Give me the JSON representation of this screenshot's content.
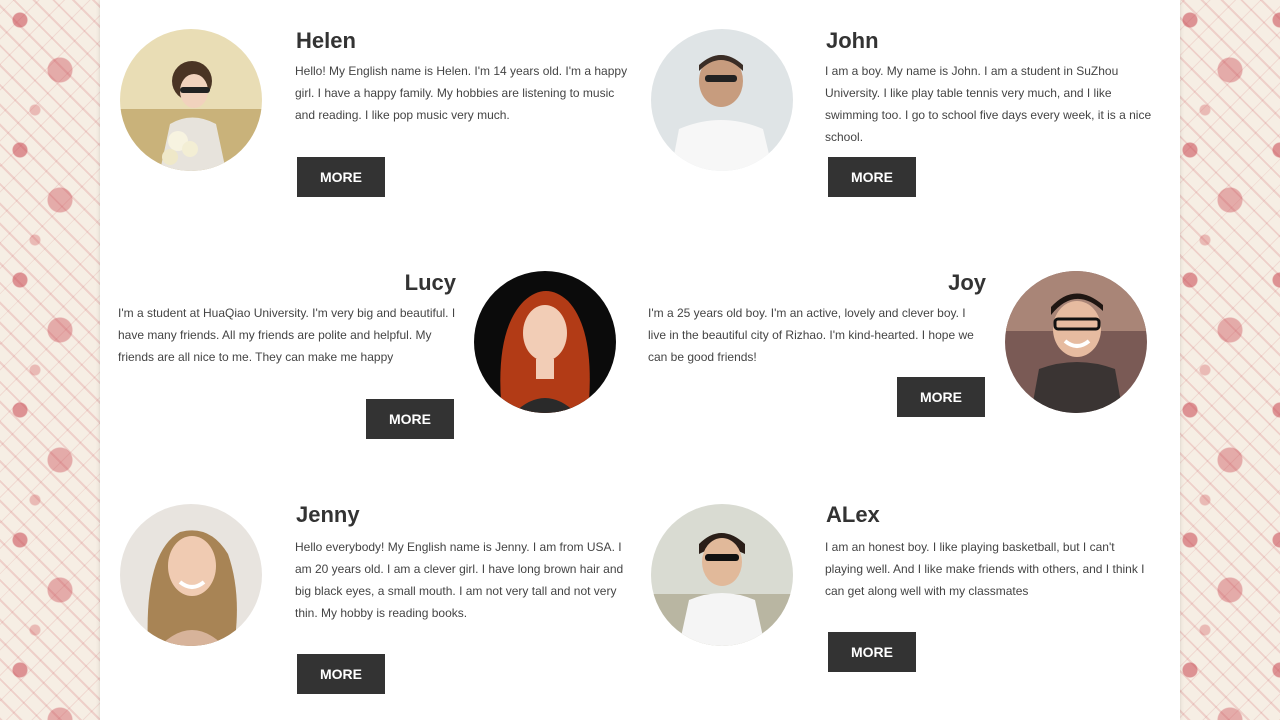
{
  "profiles": [
    {
      "name": "Helen",
      "bio": "Hello! My English name is Helen. I'm 14 years old. I'm a happy girl. I have a happy family. My hobbies are listening to music and reading. I like pop music very much.",
      "more": "MORE"
    },
    {
      "name": "John",
      "bio": "I am a boy. My name is John. I am a student in SuZhou University. I like play table tennis very much, and I like swimming too. I go to school five days every week, it is a nice school.",
      "more": "MORE"
    },
    {
      "name": "Lucy",
      "bio": "I'm a student at HuaQiao University. I'm very big and beautiful. I have many friends. All my friends are polite and helpful. My friends are all nice to me. They can make me happy",
      "more": "MORE"
    },
    {
      "name": "Joy",
      "bio": "I'm a 25 years old boy. I'm an active, lovely and clever boy. I live in the beautiful city of Rizhao. I'm kind-hearted. I hope we can be good friends!",
      "more": "MORE"
    },
    {
      "name": "Jenny",
      "bio": "Hello everybody! My English name is Jenny. I am from USA. I am 20 years old. I am a clever girl. I have long brown hair and big black eyes, a small mouth. I am not very tall and not very thin. My hobby is reading books.",
      "more": "MORE"
    },
    {
      "name": "ALex",
      "bio": "I am an honest boy. I like playing basketball, but I can't playing well. And I like make friends with others, and I think I can get along well with my classmates",
      "more": "MORE"
    }
  ],
  "colors": {
    "button_bg": "#333333",
    "page_bg": "#ffffff"
  }
}
